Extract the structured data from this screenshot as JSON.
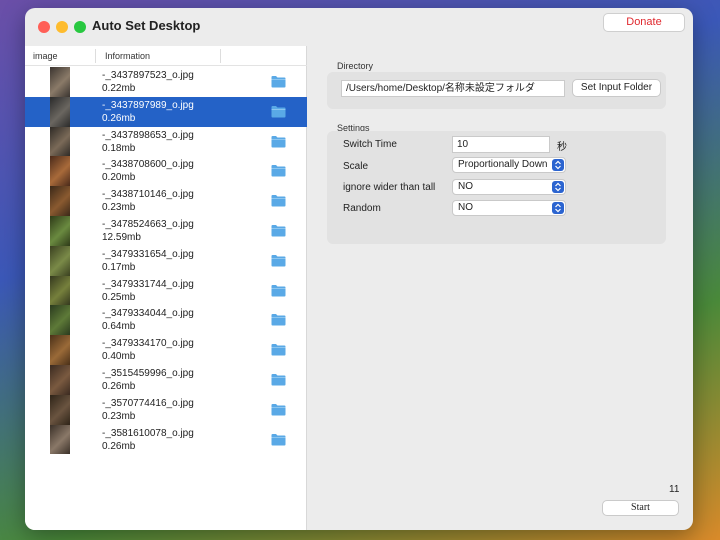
{
  "window": {
    "title": "Auto Set Desktop",
    "donate_label": "Donate"
  },
  "list": {
    "headers": {
      "image": "image",
      "information": "Information"
    },
    "selected_index": 1,
    "items": [
      {
        "name": "-_3437897523_o.jpg",
        "size": "0.22mb"
      },
      {
        "name": "-_3437897989_o.jpg",
        "size": "0.26mb"
      },
      {
        "name": "-_3437898653_o.jpg",
        "size": "0.18mb"
      },
      {
        "name": "-_3438708600_o.jpg",
        "size": "0.20mb"
      },
      {
        "name": "-_3438710146_o.jpg",
        "size": "0.23mb"
      },
      {
        "name": "-_3478524663_o.jpg",
        "size": "12.59mb"
      },
      {
        "name": "-_3479331654_o.jpg",
        "size": "0.17mb"
      },
      {
        "name": "-_3479331744_o.jpg",
        "size": "0.25mb"
      },
      {
        "name": "-_3479334044_o.jpg",
        "size": "0.64mb"
      },
      {
        "name": "-_3479334170_o.jpg",
        "size": "0.40mb"
      },
      {
        "name": "-_3515459996_o.jpg",
        "size": "0.26mb"
      },
      {
        "name": "-_3570774416_o.jpg",
        "size": "0.23mb"
      },
      {
        "name": "-_3581610078_o.jpg",
        "size": "0.26mb"
      }
    ]
  },
  "directory": {
    "label": "Directory",
    "path": "/Users/home/Desktop/名称未設定フォルダ",
    "set_button": "Set Input Folder"
  },
  "settings": {
    "label": "Settings",
    "switch_time": {
      "label": "Switch Time",
      "value": "10",
      "unit": "秒"
    },
    "scale": {
      "label": "Scale",
      "value": "Proportionally Down"
    },
    "ignore_wider": {
      "label": "ignore wider than tall",
      "value": "NO"
    },
    "random": {
      "label": "Random",
      "value": "NO"
    }
  },
  "footer": {
    "count": "11",
    "start_label": "Start"
  },
  "colors": {
    "selection": "#2462c7",
    "donate_text": "#e0282e",
    "folder_icon": "#5aa9e6",
    "popup_accent": "#2b64d0"
  },
  "icons": {
    "row_action": "folder-icon",
    "popup": "chevron-updown-icon"
  }
}
